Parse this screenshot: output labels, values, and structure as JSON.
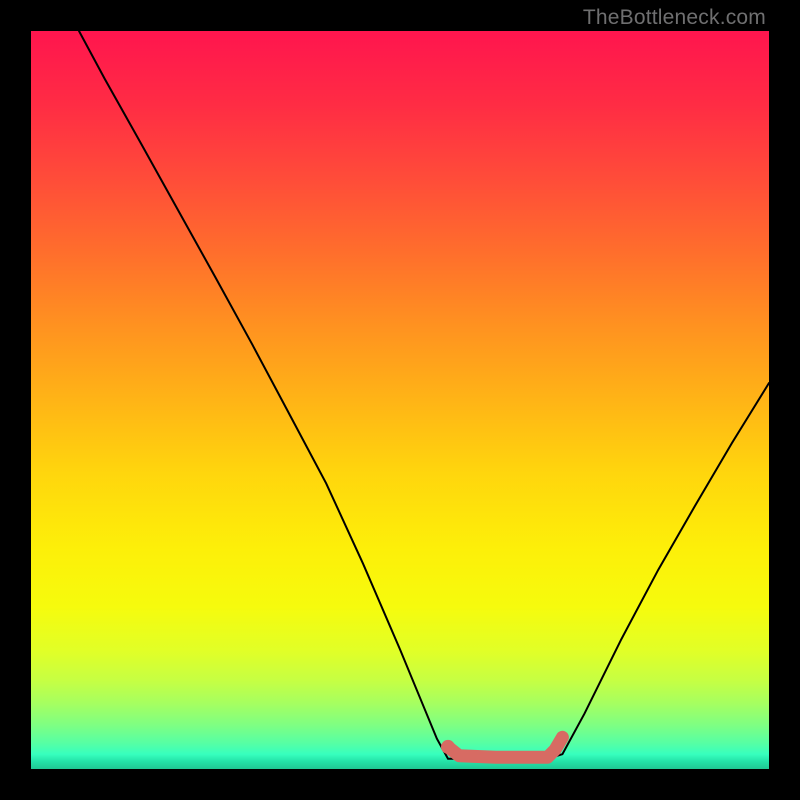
{
  "watermark": "TheBottleneck.com",
  "chart_data": {
    "type": "line",
    "title": "",
    "xlabel": "",
    "ylabel": "",
    "xlim": [
      0,
      100
    ],
    "ylim": [
      0,
      100
    ],
    "grid": false,
    "series": [
      {
        "name": "bottleneck-curve",
        "color": "#000000",
        "x": [
          6.5,
          10,
          15,
          20,
          25,
          30,
          35,
          40,
          45,
          50,
          55,
          56.5,
          70,
          72,
          75,
          80,
          85,
          90,
          95,
          100
        ],
        "y": [
          100,
          93.5,
          84.6,
          75.6,
          66.6,
          57.5,
          48.1,
          38.7,
          27.8,
          16.2,
          4.1,
          1.4,
          1.4,
          2.0,
          7.5,
          17.6,
          27.0,
          35.7,
          44.2,
          52.3
        ]
      },
      {
        "name": "sweet-spot-band",
        "color": "#d76b63",
        "x": [
          56.5,
          58,
          63,
          68,
          70,
          71,
          72
        ],
        "y": [
          3.0,
          1.8,
          1.6,
          1.6,
          1.6,
          2.6,
          4.3
        ]
      }
    ],
    "annotation_dot": {
      "x": 56.5,
      "y": 3.0,
      "color": "#d76b63"
    }
  }
}
